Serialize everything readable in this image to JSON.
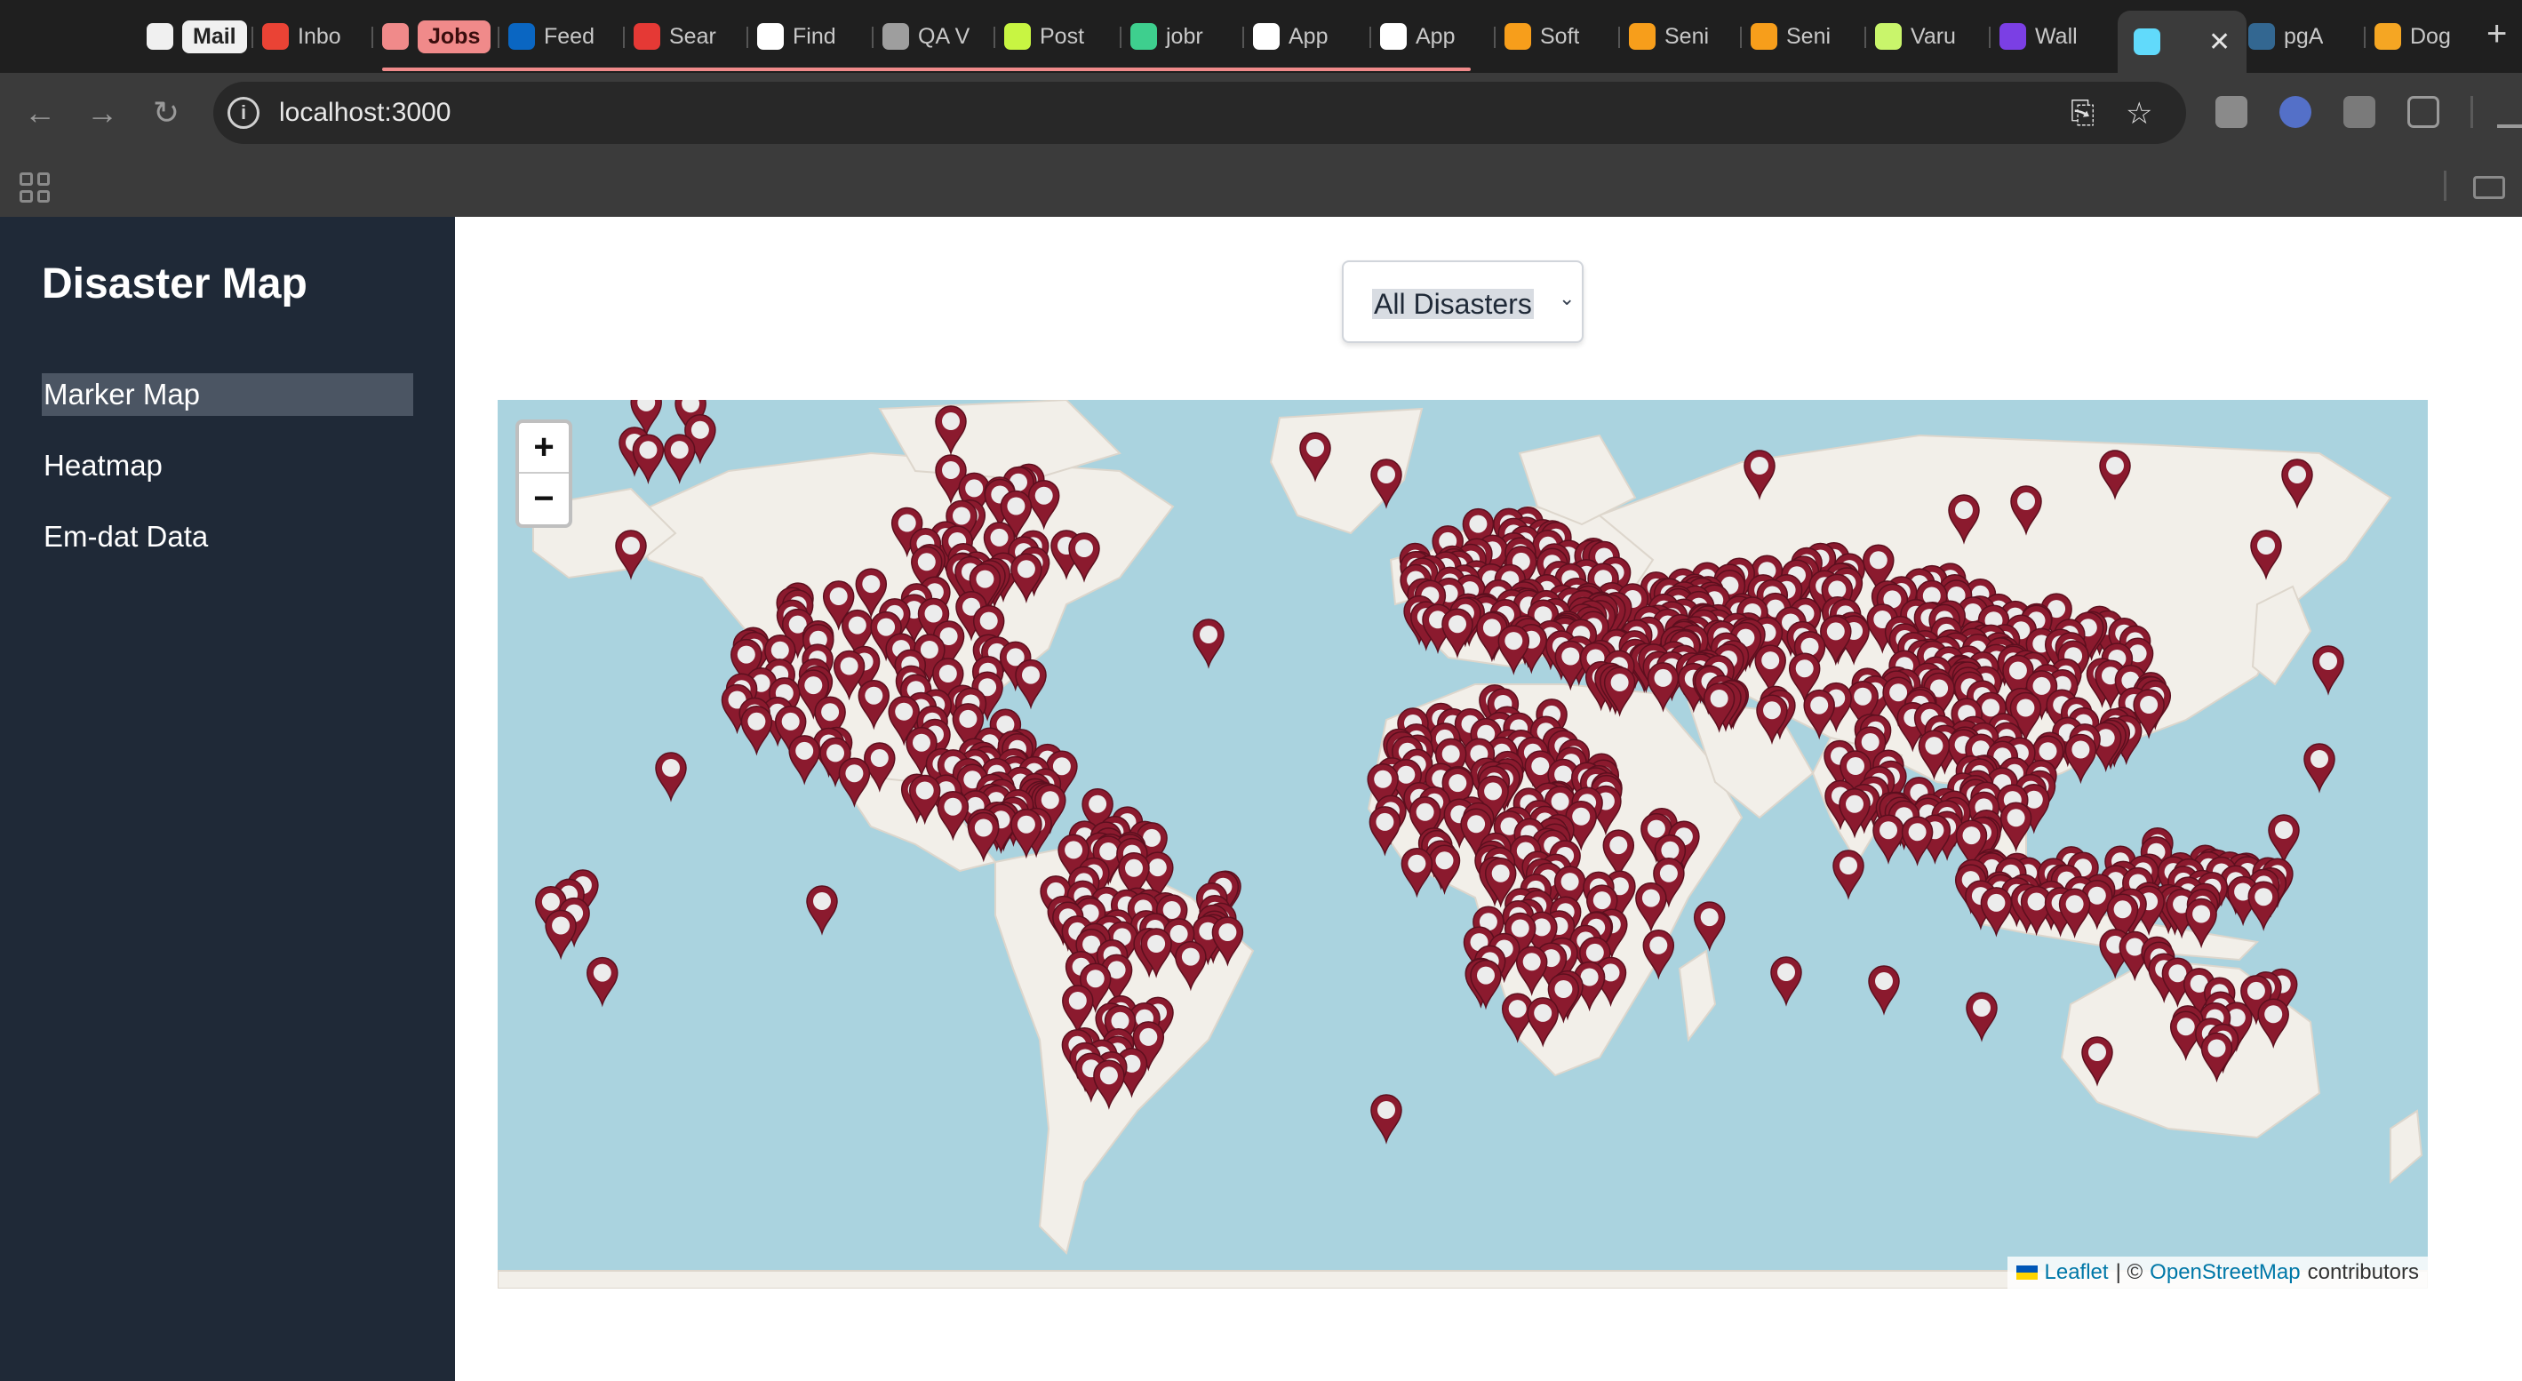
{
  "browser": {
    "tabs": [
      {
        "label": "Mail",
        "icon": "github-icon",
        "color": "#f0f0f0",
        "pill": true,
        "active": false
      },
      {
        "label": "Inbo",
        "icon": "gmail-icon",
        "color": "#ea4335",
        "active": false
      },
      {
        "label": "Jobs",
        "icon": "github-icon",
        "color": "#f08a8a",
        "pill": true,
        "active": false
      },
      {
        "label": "Feed",
        "icon": "linkedin-icon",
        "color": "#0a66c2",
        "active": false
      },
      {
        "label": "Sear",
        "icon": "oracle-icon",
        "color": "#e53935",
        "active": false
      },
      {
        "label": "Find",
        "icon": "wellfound-icon",
        "color": "#ffffff",
        "active": false
      },
      {
        "label": "QA V",
        "icon": "bird-icon",
        "color": "#9e9e9e",
        "active": false
      },
      {
        "label": "Post",
        "icon": "handshake-icon",
        "color": "#c8f542",
        "active": false
      },
      {
        "label": "jobr",
        "icon": "jobright-icon",
        "color": "#3ecf8e",
        "active": false
      },
      {
        "label": "App",
        "icon": "amazon-icon",
        "color": "#ffffff",
        "active": false
      },
      {
        "label": "App",
        "icon": "amazon-icon",
        "color": "#ffffff",
        "active": false
      },
      {
        "label": "Soft",
        "icon": "mastercard-icon",
        "color": "#f79e1b",
        "active": false
      },
      {
        "label": "Seni",
        "icon": "mastercard-icon",
        "color": "#f79e1b",
        "active": false
      },
      {
        "label": "Seni",
        "icon": "mastercard-icon",
        "color": "#f79e1b",
        "active": false
      },
      {
        "label": "Varu",
        "icon": "v-icon",
        "color": "#c9f56b",
        "active": false
      },
      {
        "label": "Wall",
        "icon": "b-icon",
        "color": "#7b3fe4",
        "active": false
      },
      {
        "label": "",
        "icon": "react-icon",
        "color": "#61dafb",
        "active": true
      },
      {
        "label": "pgA",
        "icon": "pgadmin-icon",
        "color": "#336791",
        "active": false
      },
      {
        "label": "Dog",
        "icon": "dog-icon",
        "color": "#f5a623",
        "active": false
      }
    ],
    "url": "localhost:3000"
  },
  "sidebar": {
    "title": "Disaster Map",
    "items": [
      {
        "label": "Marker Map",
        "active": true
      },
      {
        "label": "Heatmap",
        "active": false
      },
      {
        "label": "Em-dat Data",
        "active": false
      }
    ]
  },
  "filter": {
    "selected": "All Disasters"
  },
  "map": {
    "zoom_in": "+",
    "zoom_out": "−",
    "attribution": {
      "leaflet": "Leaflet",
      "separator": "| ©",
      "osm": "OpenStreetMap",
      "suffix": "contributors"
    },
    "marker_color": "#8b1a2e",
    "ocean_color": "#aad3df",
    "land_color": "#f2efe9"
  }
}
